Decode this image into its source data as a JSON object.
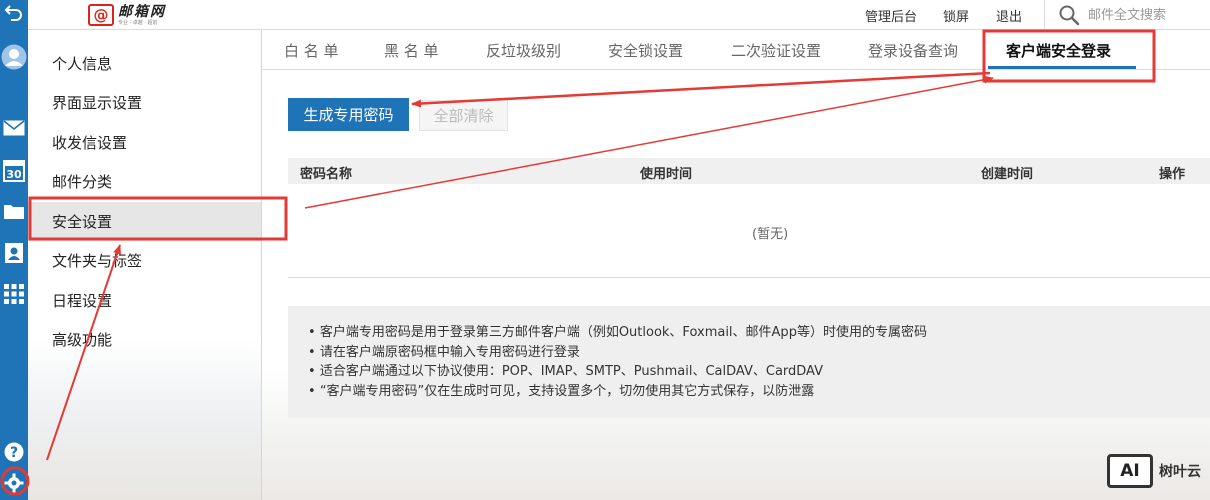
{
  "header": {
    "logo": {
      "mark": "@",
      "brand": "邮箱网",
      "slogan": "专业 · 卓越 · 超前"
    },
    "links": [
      "管理后台",
      "锁屏",
      "退出"
    ],
    "search_placeholder": "邮件全文搜索"
  },
  "sidebar_icons": [
    "back-icon",
    "avatar-icon",
    "mail-icon",
    "calendar-icon",
    "folder-icon",
    "contacts-icon",
    "apps-icon",
    "help-icon",
    "settings-gear-icon"
  ],
  "calendar_day": "30",
  "menu": {
    "items": [
      "个人信息",
      "界面显示设置",
      "收发信设置",
      "邮件分类",
      "安全设置",
      "文件夹与标签",
      "日程设置",
      "高级功能"
    ],
    "active_index": 4
  },
  "tabs": {
    "items": [
      "白 名 单",
      "黑 名 单",
      "反垃圾级别",
      "安全锁设置",
      "二次验证设置",
      "登录设备查询",
      "客户端安全登录"
    ],
    "active_index": 6
  },
  "buttons": {
    "generate": "生成专用密码",
    "clear_all": "全部清除"
  },
  "table": {
    "columns": [
      "密码名称",
      "使用时间",
      "创建时间",
      "操作"
    ],
    "empty_text": "(暂无)"
  },
  "notes": [
    "客户端专用密码是用于登录第三方邮件客户端（例如Outlook、Foxmail、邮件App等）时使用的专属密码",
    "请在客户端原密码框中输入专用密码进行登录",
    "适合客户端通过以下协议使用：POP、IMAP、SMTP、Pushmail、CalDAV、CardDAV",
    "“客户端专用密码”仅在生成时可见，支持设置多个，切勿使用其它方式保存，以防泄露"
  ],
  "colors": {
    "accent": "#1f73b7",
    "annotation": "#e53935"
  },
  "watermark": {
    "logo": "AI",
    "text": "树叶云"
  }
}
